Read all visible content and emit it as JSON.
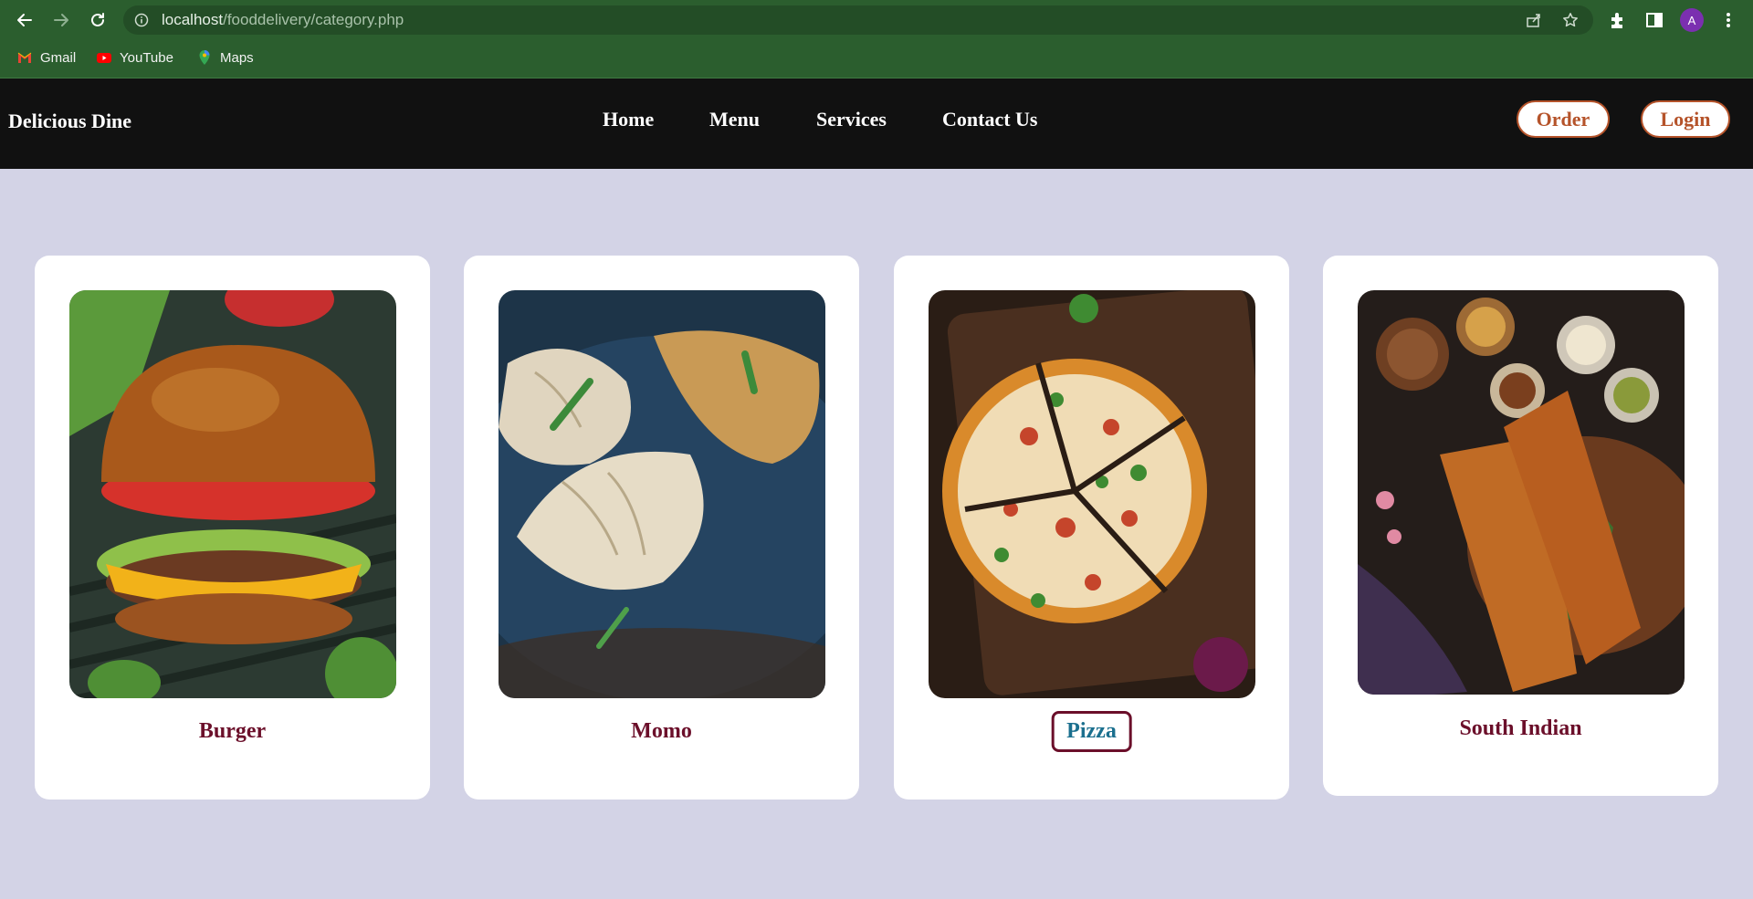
{
  "browser": {
    "url_host": "localhost",
    "url_path": "/fooddelivery/category.php",
    "avatar_letter": "A",
    "bookmarks": [
      {
        "label": "Gmail",
        "icon": "gmail-icon"
      },
      {
        "label": "YouTube",
        "icon": "youtube-icon"
      },
      {
        "label": "Maps",
        "icon": "maps-icon"
      }
    ]
  },
  "site": {
    "brand": "Delicious Dine",
    "nav": [
      "Home",
      "Menu",
      "Services",
      "Contact Us"
    ],
    "order_label": "Order",
    "login_label": "Login"
  },
  "categories": [
    {
      "name": "Burger",
      "image": "burger"
    },
    {
      "name": "Momo",
      "image": "momo"
    },
    {
      "name": "Pizza",
      "image": "pizza",
      "highlighted": true
    },
    {
      "name": "South Indian",
      "image": "dosa"
    }
  ],
  "colors": {
    "chrome": "#2b5e2e",
    "header": "#111111",
    "page_bg": "#d3d3e6",
    "accent": "#b5532a",
    "card_title": "#6b0f2a",
    "active_title": "#1a6f8e"
  }
}
